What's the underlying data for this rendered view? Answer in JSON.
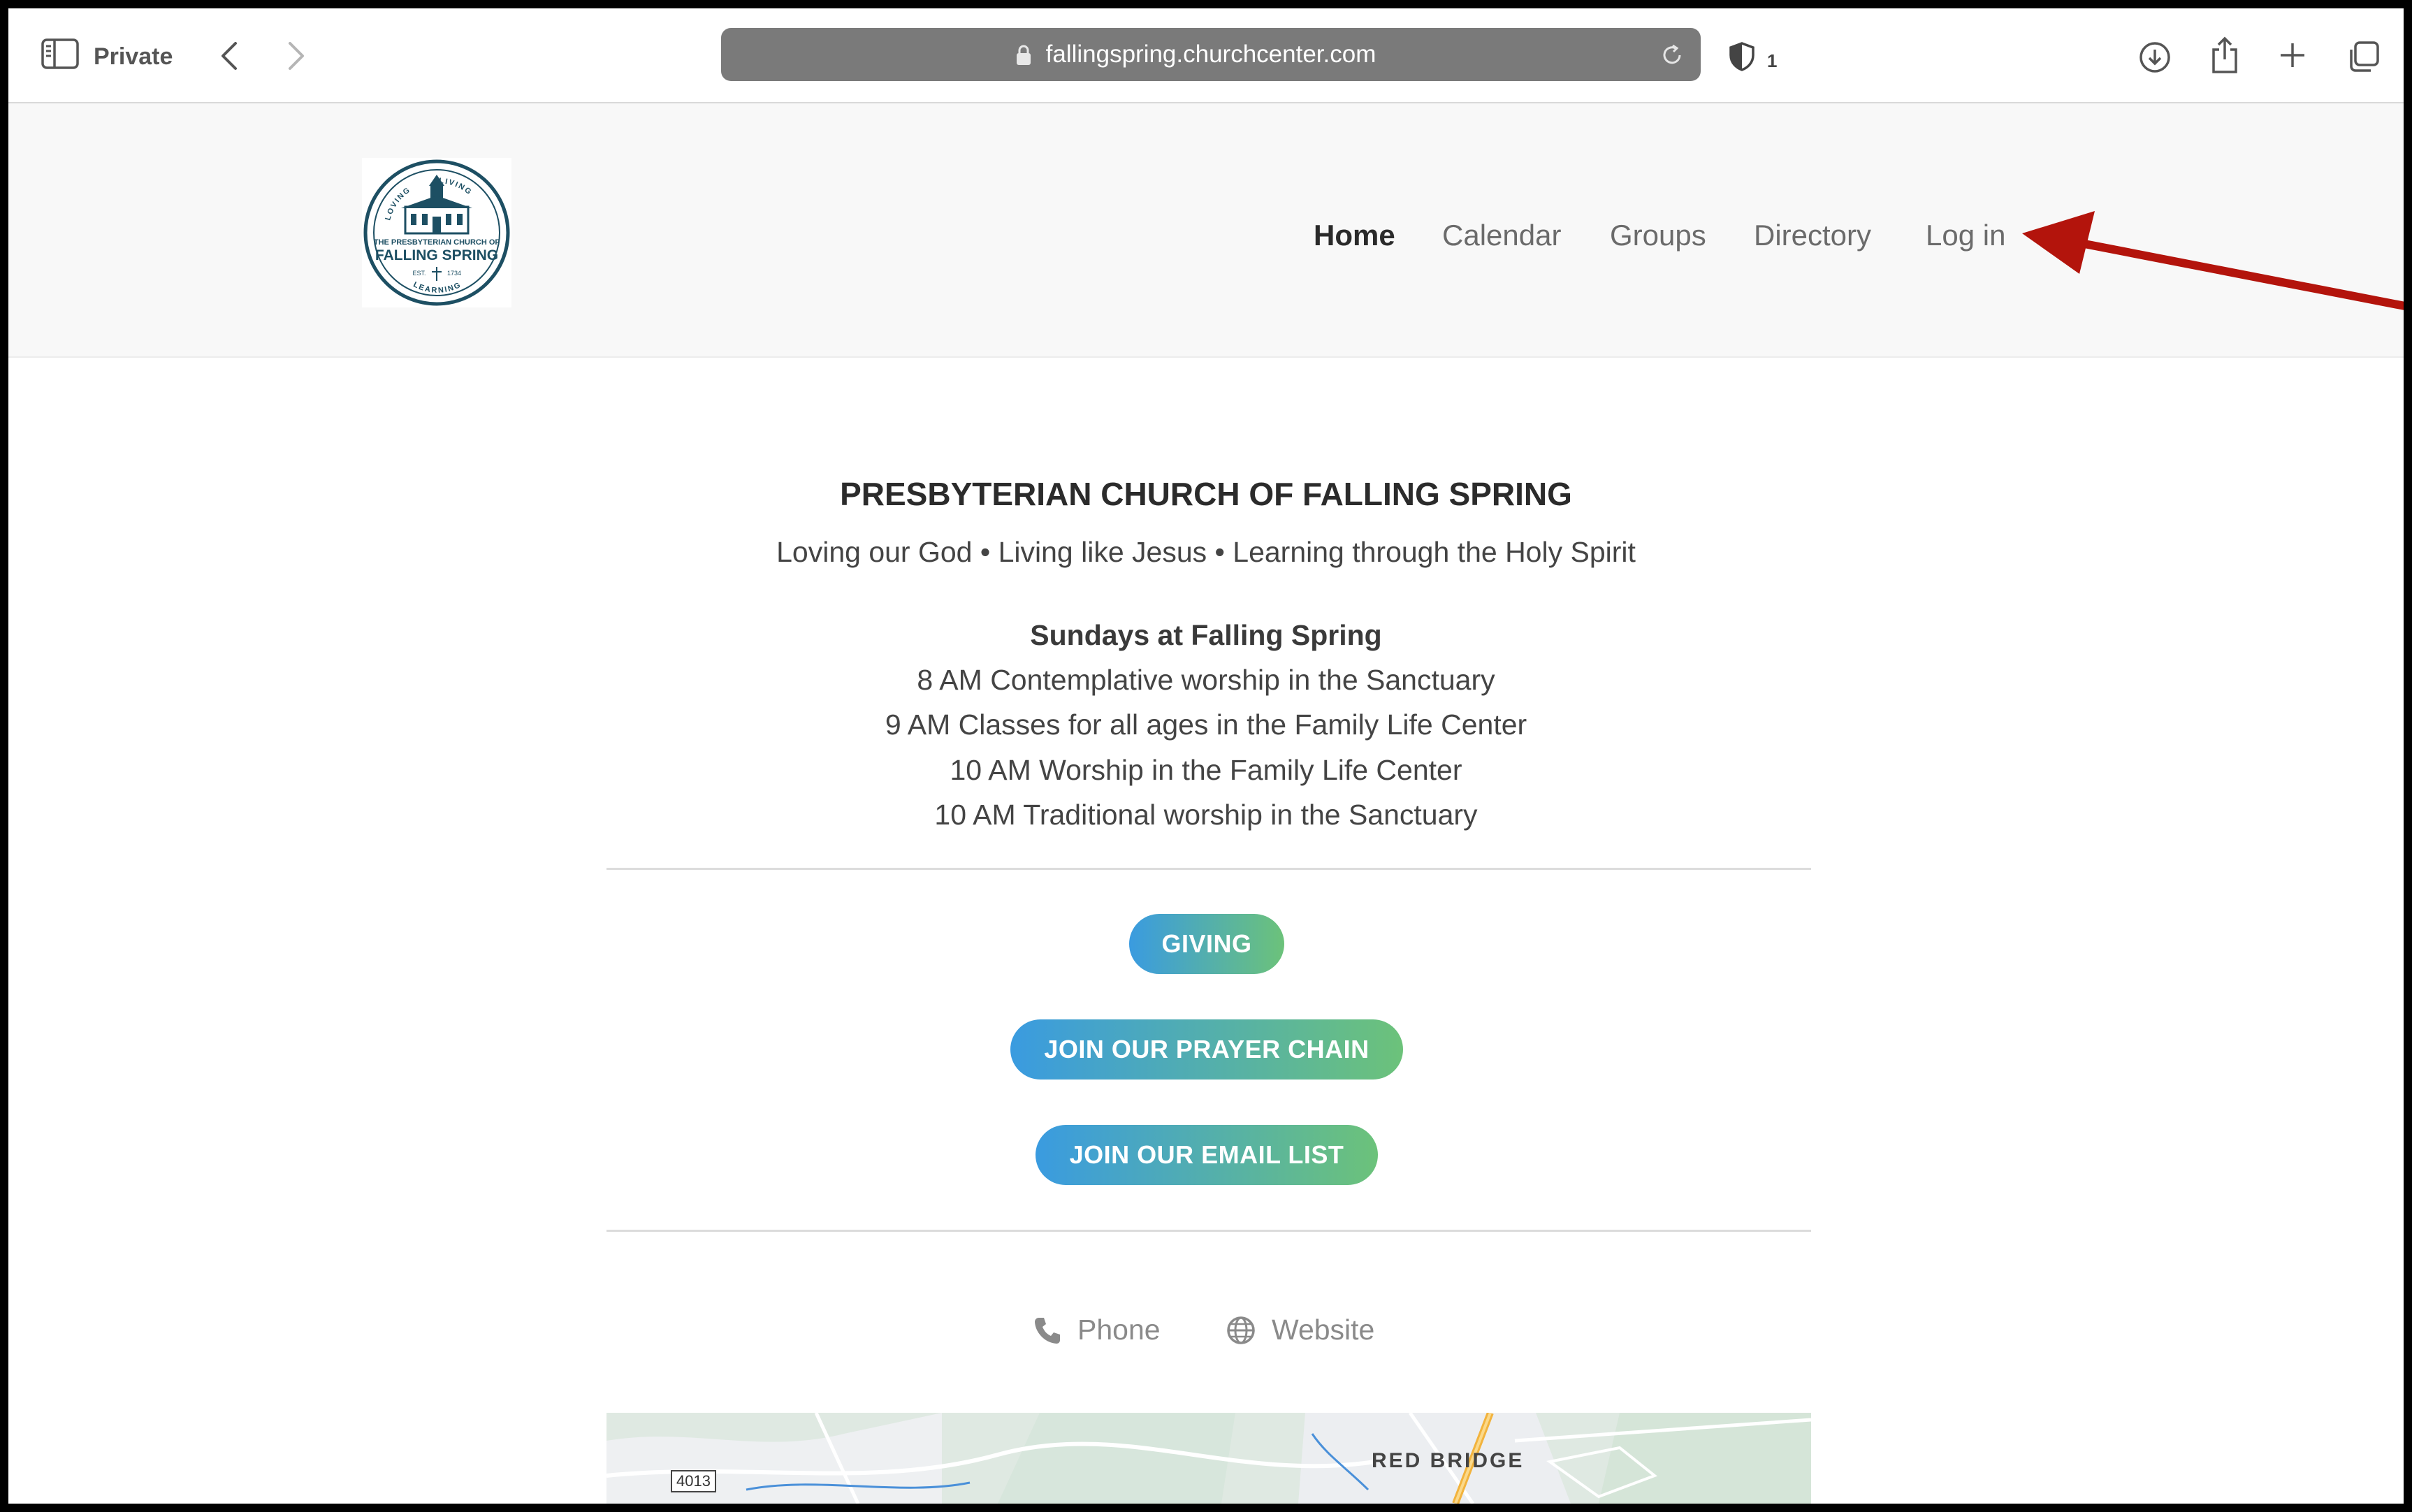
{
  "browser": {
    "private_label": "Private",
    "url": "fallingspring.churchcenter.com",
    "tracker_count": "1",
    "icons": [
      "sidebar-icon",
      "back-icon",
      "forward-icon",
      "lock-icon",
      "reload-icon",
      "shield-icon",
      "download-icon",
      "share-icon",
      "new-tab-icon",
      "tab-overview-icon"
    ]
  },
  "nav": {
    "home": "Home",
    "calendar": "Calendar",
    "groups": "Groups",
    "directory": "Directory",
    "login": "Log in"
  },
  "logo": {
    "arc_top_left": "LOVING",
    "arc_top_right": "LIVING",
    "line1": "THE PRESBYTERIAN CHURCH OF",
    "line2": "FALLING SPRING",
    "est": "EST.",
    "year": "1734",
    "arc_bottom": "LEARNING"
  },
  "main": {
    "church_name": "PRESBYTERIAN CHURCH OF FALLING SPRING",
    "tagline": "Loving our God • Living like Jesus • Learning through the Holy Spirit",
    "schedule_title": "Sundays at Falling Spring",
    "schedule": [
      "8 AM Contemplative worship in the Sanctuary",
      "9 AM Classes for all ages in the Family Life Center",
      "10 AM Worship in the Family Life Center",
      "10 AM Traditional worship in the Sanctuary"
    ],
    "buttons": {
      "giving": "GIVING",
      "prayer_chain": "JOIN OUR PRAYER CHAIN",
      "email_list": "JOIN OUR EMAIL LIST"
    },
    "contact": {
      "phone": "Phone",
      "website": "Website"
    }
  },
  "map": {
    "place_label": "RED BRIDGE",
    "road_label": "4013"
  },
  "annotation": {
    "arrow_color": "#b3140c"
  }
}
